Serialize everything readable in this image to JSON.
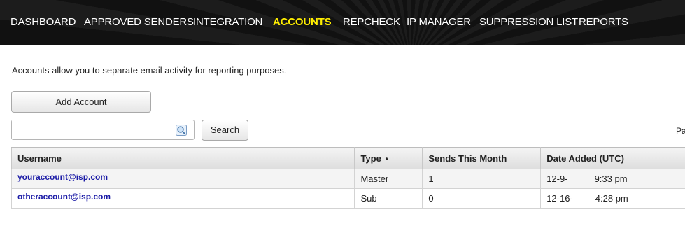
{
  "nav": {
    "items": [
      {
        "label": "DASHBOARD"
      },
      {
        "label": "APPROVED SENDERS"
      },
      {
        "label": "INTEGRATION"
      },
      {
        "label": "ACCOUNTS",
        "active": true
      },
      {
        "label": "REPCHECK"
      },
      {
        "label": "IP MANAGER"
      },
      {
        "label": "SUPPRESSION LIST"
      },
      {
        "label": "REPORTS"
      }
    ],
    "active_color": "#ffee00"
  },
  "intro_text": "Accounts allow you to separate email activity for reporting purposes.",
  "buttons": {
    "add_account": "Add Account",
    "search": "Search"
  },
  "search": {
    "value": "",
    "icon": "magnifier-icon"
  },
  "pagination": {
    "label": "Pa"
  },
  "table": {
    "headers": {
      "username": "Username",
      "type": "Type",
      "sends": "Sends This Month",
      "date_added": "Date Added (UTC)"
    },
    "sort_indicator": "▲",
    "rows": [
      {
        "username": "youraccount@isp.com",
        "type": "Master",
        "sends": "1",
        "date": "12-9-",
        "time": "9:33 pm"
      },
      {
        "username": "otheraccount@isp.com",
        "type": "Sub",
        "sends": "0",
        "date": "12-16-",
        "time": "4:28 pm"
      }
    ]
  }
}
